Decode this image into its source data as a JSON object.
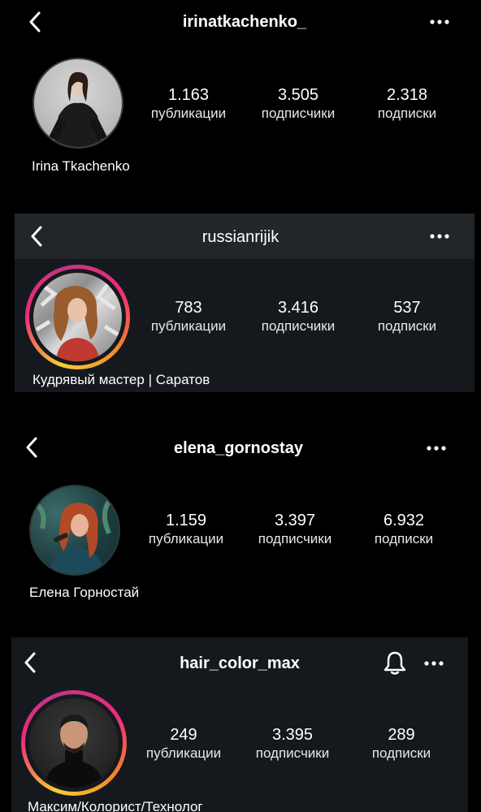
{
  "profiles": [
    {
      "username": "irinatkachenko_",
      "name": "Irina Tkachenko",
      "stats": [
        {
          "value": "1.163",
          "label": "публикации"
        },
        {
          "value": "3.505",
          "label": "подписчики"
        },
        {
          "value": "2.318",
          "label": "подписки"
        }
      ]
    },
    {
      "username": "russianrijik",
      "name": "Кудрявый мастер | Саратов",
      "stats": [
        {
          "value": "783",
          "label": "публикации"
        },
        {
          "value": "3.416",
          "label": "подписчики"
        },
        {
          "value": "537",
          "label": "подписки"
        }
      ]
    },
    {
      "username": "elena_gornostay",
      "name": "Елена Горностай",
      "stats": [
        {
          "value": "1.159",
          "label": "публикации"
        },
        {
          "value": "3.397",
          "label": "подписчики"
        },
        {
          "value": "6.932",
          "label": "подписки"
        }
      ]
    },
    {
      "username": "hair_color_max",
      "name": "Максим/Колорист/Технолог",
      "stats": [
        {
          "value": "249",
          "label": "публикации"
        },
        {
          "value": "3.395",
          "label": "подписчики"
        },
        {
          "value": "289",
          "label": "подписки"
        }
      ]
    }
  ],
  "icons": {
    "back": "chevron-left-icon",
    "more": "more-horizontal-icon",
    "notifications": "bell-icon"
  },
  "colors": {
    "story_ring": [
      "#f9ce34",
      "#ee2a7b",
      "#6228d7"
    ],
    "card_dark": "#15191d"
  }
}
